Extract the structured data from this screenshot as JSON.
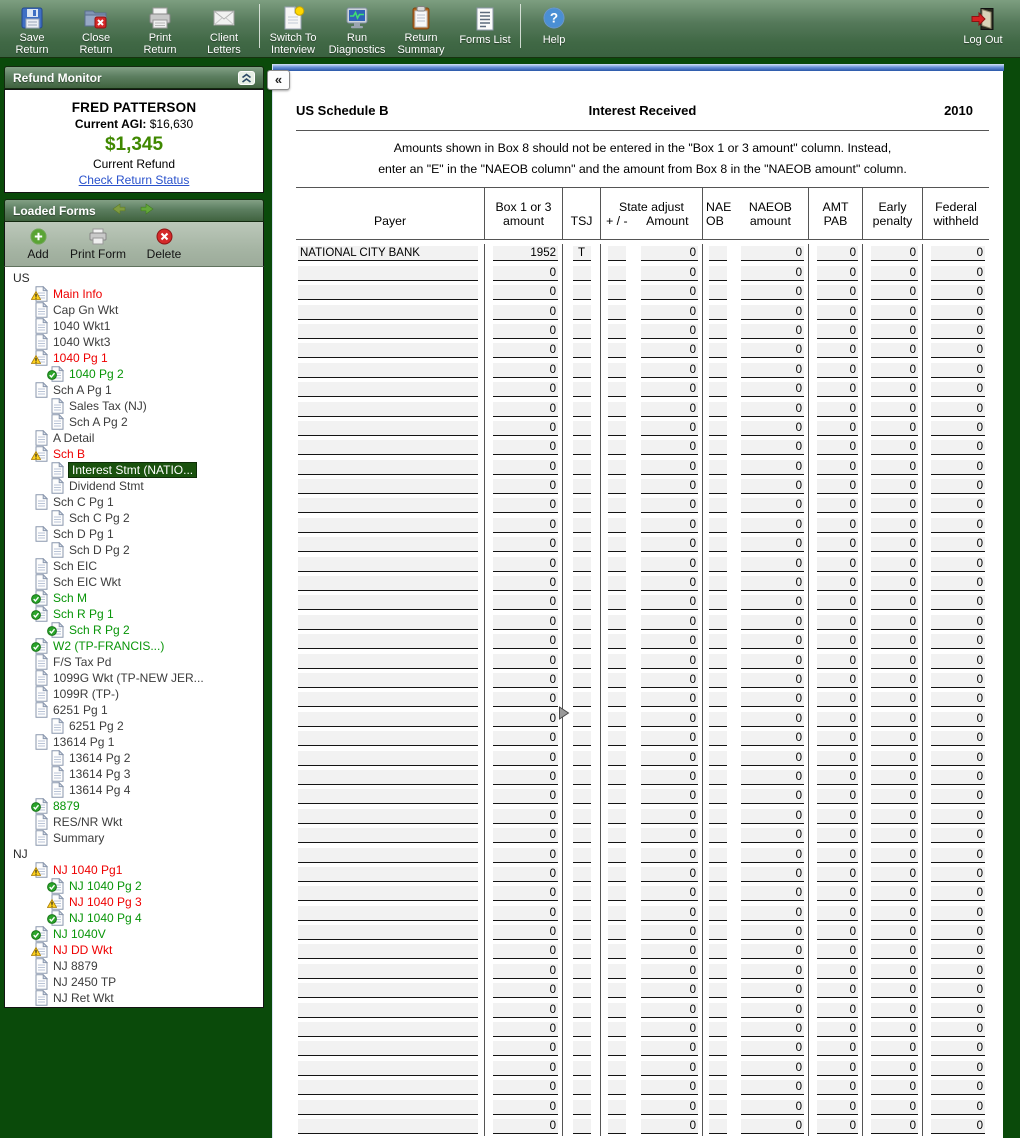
{
  "toolbar": {
    "items": [
      {
        "icon": "save-icon",
        "lines": [
          "Save",
          "Return"
        ]
      },
      {
        "icon": "close-return-icon",
        "lines": [
          "Close",
          "Return"
        ]
      },
      {
        "icon": "print-icon",
        "lines": [
          "Print",
          "Return"
        ]
      },
      {
        "icon": "envelope-icon",
        "lines": [
          "Client",
          "Letters"
        ]
      },
      {
        "divider": true
      },
      {
        "icon": "interview-icon",
        "lines": [
          "Switch To",
          "Interview"
        ]
      },
      {
        "icon": "diagnostics-icon",
        "lines": [
          "Run",
          "Diagnostics"
        ]
      },
      {
        "icon": "summary-icon",
        "lines": [
          "Return",
          "Summary"
        ]
      },
      {
        "icon": "forms-list-icon",
        "lines": [
          "Forms List"
        ]
      },
      {
        "divider": true
      },
      {
        "icon": "help-icon",
        "lines": [
          "Help"
        ]
      }
    ],
    "logout": {
      "icon": "logout-icon",
      "lines": [
        "Log Out"
      ]
    }
  },
  "refund_monitor": {
    "title": "Refund Monitor",
    "client_name": "FRED PATTERSON",
    "agi_label": "Current AGI:",
    "agi_value": "$16,630",
    "refund_amount": "$1,345",
    "refund_label": "Current Refund",
    "link": "Check Return Status"
  },
  "loaded_forms": {
    "title": "Loaded Forms",
    "buttons": [
      {
        "icon": "add-icon",
        "label": "Add"
      },
      {
        "icon": "print-form-icon",
        "label": "Print Form"
      },
      {
        "icon": "delete-icon",
        "label": "Delete"
      }
    ],
    "tree": [
      {
        "label": "US",
        "level": 0,
        "state": "group"
      },
      {
        "label": "Main Info",
        "level": 1,
        "state": "error"
      },
      {
        "label": "Cap Gn Wkt",
        "level": 1,
        "state": "normal"
      },
      {
        "label": "1040 Wkt1",
        "level": 1,
        "state": "normal"
      },
      {
        "label": "1040 Wkt3",
        "level": 1,
        "state": "normal"
      },
      {
        "label": "1040 Pg 1",
        "level": 1,
        "state": "error"
      },
      {
        "label": "1040 Pg 2",
        "level": 2,
        "state": "ok"
      },
      {
        "label": "Sch A Pg 1",
        "level": 1,
        "state": "normal"
      },
      {
        "label": "Sales Tax (NJ)",
        "level": 2,
        "state": "normal"
      },
      {
        "label": "Sch A Pg 2",
        "level": 2,
        "state": "normal"
      },
      {
        "label": "A Detail",
        "level": 1,
        "state": "normal"
      },
      {
        "label": "Sch B",
        "level": 1,
        "state": "error"
      },
      {
        "label": "Interest Stmt (NATIO...",
        "level": 2,
        "state": "normal",
        "selected": true
      },
      {
        "label": "Dividend Stmt",
        "level": 2,
        "state": "normal"
      },
      {
        "label": "Sch C Pg 1",
        "level": 1,
        "state": "normal"
      },
      {
        "label": "Sch C Pg 2",
        "level": 2,
        "state": "normal"
      },
      {
        "label": "Sch D Pg 1",
        "level": 1,
        "state": "normal"
      },
      {
        "label": "Sch D Pg 2",
        "level": 2,
        "state": "normal"
      },
      {
        "label": "Sch EIC",
        "level": 1,
        "state": "normal"
      },
      {
        "label": "Sch EIC Wkt",
        "level": 1,
        "state": "normal"
      },
      {
        "label": "Sch M",
        "level": 1,
        "state": "ok"
      },
      {
        "label": "Sch R Pg 1",
        "level": 1,
        "state": "ok"
      },
      {
        "label": "Sch R Pg 2",
        "level": 2,
        "state": "ok"
      },
      {
        "label": "W2 (TP-FRANCIS...)",
        "level": 1,
        "state": "ok"
      },
      {
        "label": "F/S Tax Pd",
        "level": 1,
        "state": "normal"
      },
      {
        "label": "1099G Wkt  (TP-NEW JER...",
        "level": 1,
        "state": "normal"
      },
      {
        "label": "1099R (TP-)",
        "level": 1,
        "state": "normal"
      },
      {
        "label": "6251 Pg 1",
        "level": 1,
        "state": "normal"
      },
      {
        "label": "6251 Pg 2",
        "level": 2,
        "state": "normal"
      },
      {
        "label": "13614 Pg 1",
        "level": 1,
        "state": "normal"
      },
      {
        "label": "13614 Pg 2",
        "level": 2,
        "state": "normal"
      },
      {
        "label": "13614 Pg 3",
        "level": 2,
        "state": "normal"
      },
      {
        "label": "13614 Pg 4",
        "level": 2,
        "state": "normal"
      },
      {
        "label": "8879",
        "level": 1,
        "state": "ok"
      },
      {
        "label": "RES/NR Wkt",
        "level": 1,
        "state": "normal"
      },
      {
        "label": "Summary",
        "level": 1,
        "state": "normal"
      },
      {
        "label": "NJ",
        "level": 0,
        "state": "group"
      },
      {
        "label": "NJ 1040 Pg1",
        "level": 1,
        "state": "error"
      },
      {
        "label": "NJ 1040 Pg 2",
        "level": 2,
        "state": "ok"
      },
      {
        "label": "NJ 1040 Pg 3",
        "level": 2,
        "state": "error"
      },
      {
        "label": "NJ 1040 Pg 4",
        "level": 2,
        "state": "ok"
      },
      {
        "label": "NJ 1040V",
        "level": 1,
        "state": "ok"
      },
      {
        "label": "NJ DD Wkt",
        "level": 1,
        "state": "error"
      },
      {
        "label": "NJ 8879",
        "level": 1,
        "state": "normal"
      },
      {
        "label": "NJ 2450 TP",
        "level": 1,
        "state": "normal"
      },
      {
        "label": "NJ Ret Wkt",
        "level": 1,
        "state": "normal"
      }
    ]
  },
  "form": {
    "header_left": "US Schedule B",
    "header_center": "Interest Received",
    "header_right": "2010",
    "instructions_line1": "Amounts shown in Box 8 should not be entered in the  \"Box 1 or 3 amount\"  column.  Instead,",
    "instructions_line2": "enter an  \"E\"  in the  \"NAEOB column\"  and the amount from Box 8 in the  \"NAEOB amount\"  column.",
    "columns": {
      "payer": "Payer",
      "box_line1": "Box 1 or 3",
      "box_line2": "amount",
      "tsj": "TSJ",
      "state_adjust": "State adjust",
      "plus_minus": "+ / -",
      "amount": "Amount",
      "naeob_line1": "NAE",
      "naeob_line2": "OB",
      "naeob_amt_line1": "NAEOB",
      "naeob_amt_line2": "amount",
      "amt_pab_line1": "AMT",
      "amt_pab_line2": "PAB",
      "early_line1": "Early",
      "early_line2": "penalty",
      "federal_line1": "Federal",
      "federal_line2": "withheld"
    },
    "first_row": {
      "payer": "NATIONAL CITY BANK",
      "box": "1952",
      "tsj": "T",
      "plus": "",
      "amount": "0",
      "naeob": "",
      "naeob_amount": "0",
      "amt_pab": "0",
      "early": "0",
      "federal": "0"
    },
    "empty_row": {
      "payer": "",
      "box": "0",
      "tsj": "",
      "plus": "",
      "amount": "0",
      "naeob": "",
      "naeob_amount": "0",
      "amt_pab": "0",
      "early": "0",
      "federal": "0"
    },
    "empty_row_count": 45
  },
  "colors": {
    "toolbar_green": "#55795a",
    "background_green": "#0a4a0a",
    "selected_tree_green": "#1a520e",
    "error_red": "#ee0000",
    "ok_green": "#089508",
    "refund_green": "#3f8800",
    "link_blue": "#2a52cc"
  }
}
